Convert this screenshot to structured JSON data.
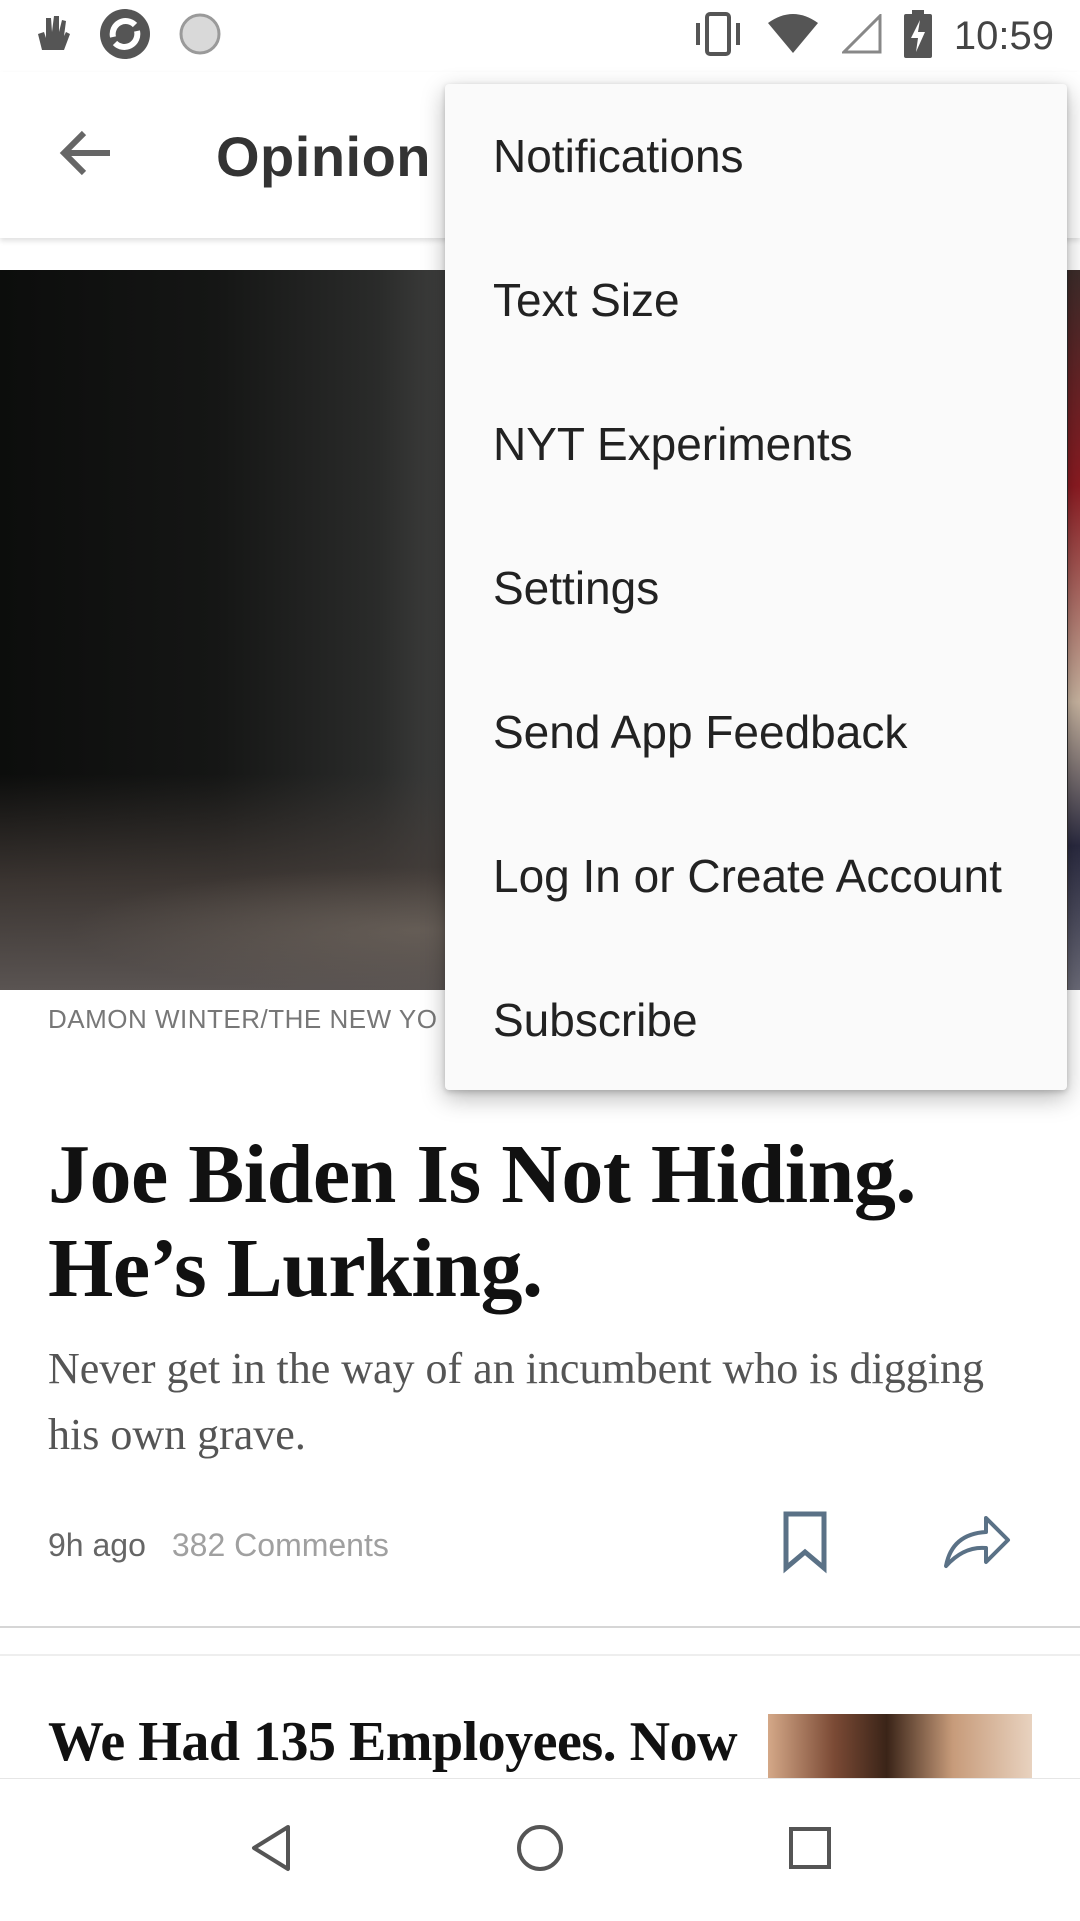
{
  "status_bar": {
    "time": "10:59",
    "left_icons": [
      "touch-gesture-icon",
      "app-sync-icon",
      "loading-circle-icon"
    ],
    "right_icons": [
      "vibrate-icon",
      "wifi-icon",
      "cell-signal-icon",
      "battery-charging-icon"
    ]
  },
  "app_bar": {
    "back_icon": "arrow-left-icon",
    "title": "Opinion"
  },
  "hero": {
    "credit": "DAMON WINTER/THE NEW YO"
  },
  "article": {
    "headline": "Joe Biden Is Not Hiding. He’s Lurking.",
    "summary": "Never get in the way of an incumbent who is digging his own grave.",
    "time": "9h ago",
    "comments": "382 Comments",
    "bookmark_icon": "bookmark-icon",
    "share_icon": "share-arrow-icon"
  },
  "next_article": {
    "headline": "We Had 135 Employees. Now"
  },
  "menu": {
    "items": [
      {
        "label": "Notifications"
      },
      {
        "label": "Text Size"
      },
      {
        "label": "NYT Experiments"
      },
      {
        "label": "Settings"
      },
      {
        "label": "Send App Feedback"
      },
      {
        "label": "Log In or Create Account"
      },
      {
        "label": "Subscribe"
      }
    ]
  },
  "nav_bar": {
    "back": "nav-back-icon",
    "home": "nav-home-icon",
    "recents": "nav-recents-icon"
  }
}
